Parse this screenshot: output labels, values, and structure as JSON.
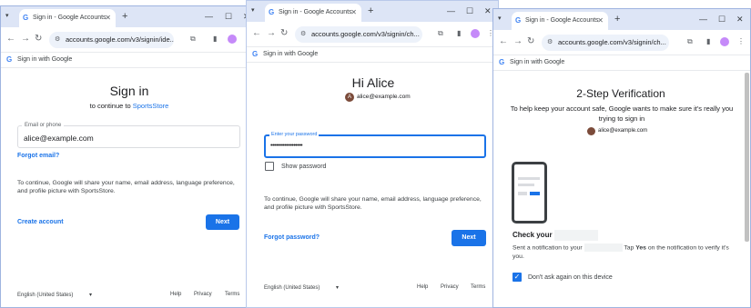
{
  "browser": {
    "tab_title": "Sign in - Google Accounts",
    "tab_menu_icon": "chevron-down",
    "new_tab": "+",
    "minimize": "—",
    "maximize": "☐",
    "close": "✕",
    "sign_in_with_google": "Sign in with Google"
  },
  "window1": {
    "url": "accounts.google.com/v3/signin/ide...",
    "heading": "Sign in",
    "subheading_prefix": "to continue to ",
    "app_name": "SportsStore",
    "email_label": "Email or phone",
    "email_value": "alice@example.com",
    "forgot_email": "Forgot email?",
    "disclaimer": "To continue, Google will share your name, email address, language preference, and profile picture with SportsStore.",
    "create_account": "Create account",
    "next": "Next",
    "language": "English (United States)",
    "help": "Help",
    "privacy": "Privacy",
    "terms": "Terms"
  },
  "window2": {
    "url": "accounts.google.com/v3/signin/ch...",
    "heading": "Hi Alice",
    "account_initial": "A",
    "account_email": "alice@example.com",
    "password_label": "Enter your password",
    "password_value": "••••••••••••••••••",
    "show_password": "Show password",
    "disclaimer": "To continue, Google will share your name, email address, language preference, and profile picture with SportsStore.",
    "forgot_password": "Forgot password?",
    "next": "Next",
    "language": "English (United States)",
    "help": "Help",
    "privacy": "Privacy",
    "terms": "Terms"
  },
  "window3": {
    "url": "accounts.google.com/v3/signin/ch...",
    "heading": "2-Step Verification",
    "description": "To help keep your account safe, Google wants to make sure it's really you trying to sign in",
    "account_email": "alice@example.com",
    "check_title": "Check your",
    "notif_prefix": "Sent a notification to your",
    "notif_tap": "Tap",
    "notif_yes": "Yes",
    "notif_suffix": "on the notification to verify it's you.",
    "dont_ask": "Don't ask again on this device"
  },
  "colors": {
    "accent": "#1a73e8",
    "tabbar": "#dde5f6",
    "phone_frame": "#3c4043"
  }
}
